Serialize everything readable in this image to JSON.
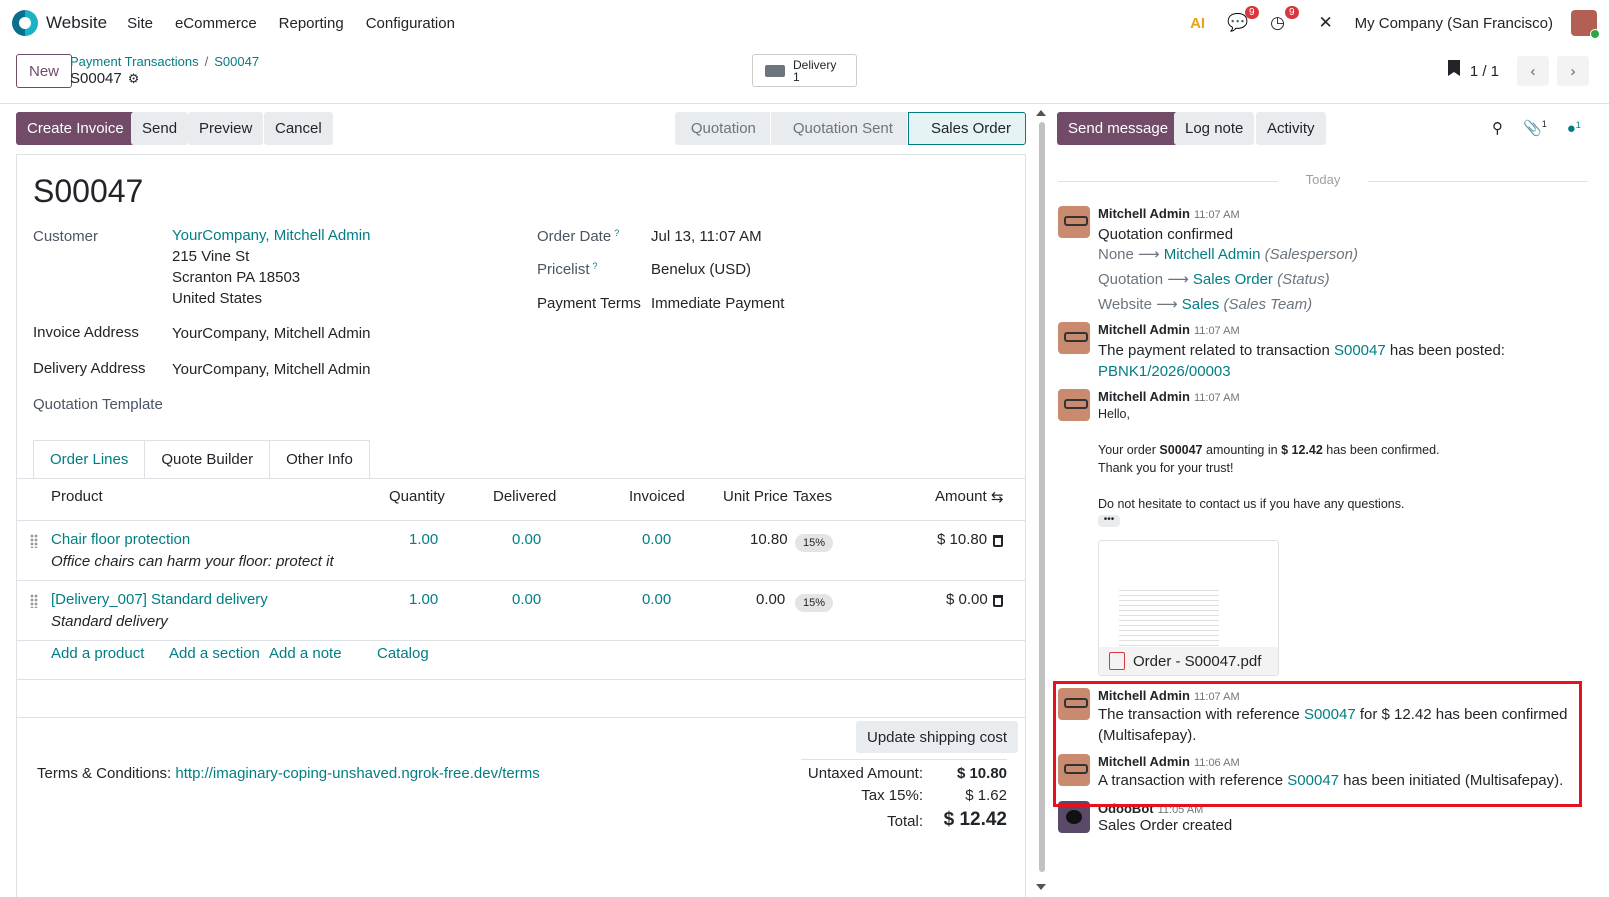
{
  "navbar": {
    "brand": "Website",
    "menu": [
      "Site",
      "eCommerce",
      "Reporting",
      "Configuration"
    ],
    "ai_label": "AI",
    "messages_badge": "9",
    "activity_badge": "9",
    "company": "My Company (San Francisco)"
  },
  "control": {
    "new_label": "New",
    "breadcrumb_parent": "Payment Transactions",
    "breadcrumb_current": "S00047",
    "record_name": "S00047",
    "smart_delivery_label": "Delivery",
    "smart_delivery_count": "1",
    "pager": "1 / 1"
  },
  "statusbar": {
    "create_invoice": "Create Invoice",
    "send": "Send",
    "preview": "Preview",
    "cancel": "Cancel",
    "stages": [
      "Quotation",
      "Quotation Sent",
      "Sales Order"
    ]
  },
  "form": {
    "title": "S00047",
    "customer_label": "Customer",
    "customer_name": "YourCompany, Mitchell Admin",
    "customer_addr1": "215 Vine St",
    "customer_addr2": "Scranton PA 18503",
    "customer_addr3": "United States",
    "invoice_address_label": "Invoice Address",
    "invoice_address": "YourCompany, Mitchell Admin",
    "delivery_address_label": "Delivery Address",
    "delivery_address": "YourCompany, Mitchell Admin",
    "quotation_template_label": "Quotation Template",
    "order_date_label": "Order Date",
    "order_date": "Jul 13, 11:07 AM",
    "pricelist_label": "Pricelist",
    "pricelist": "Benelux (USD)",
    "payment_terms_label": "Payment Terms",
    "payment_terms": "Immediate Payment",
    "help_mark": "?"
  },
  "tabs": [
    "Order Lines",
    "Quote Builder",
    "Other Info"
  ],
  "table": {
    "headers": {
      "product": "Product",
      "quantity": "Quantity",
      "delivered": "Delivered",
      "invoiced": "Invoiced",
      "unit_price": "Unit Price",
      "taxes": "Taxes",
      "amount": "Amount"
    },
    "rows": [
      {
        "product": "Chair floor protection",
        "description": "Office chairs can harm your floor: protect it",
        "quantity": "1.00",
        "delivered": "0.00",
        "invoiced": "0.00",
        "unit_price": "10.80",
        "tax": "15%",
        "amount": "$ 10.80"
      },
      {
        "product": "[Delivery_007] Standard delivery",
        "description": "Standard delivery",
        "quantity": "1.00",
        "delivered": "0.00",
        "invoiced": "0.00",
        "unit_price": "0.00",
        "tax": "15%",
        "amount": "$ 0.00"
      }
    ],
    "add_product": "Add a product",
    "add_section": "Add a section",
    "add_note": "Add a note",
    "catalog": "Catalog"
  },
  "footer": {
    "update_shipping": "Update shipping cost",
    "terms_label": "Terms & Conditions:",
    "terms_url": "http://imaginary-coping-unshaved.ngrok-free.dev/terms",
    "untaxed_label": "Untaxed Amount:",
    "untaxed_value": "$ 10.80",
    "tax_label": "Tax 15%:",
    "tax_value": "$ 1.62",
    "total_label": "Total:",
    "total_value": "$ 12.42"
  },
  "chatter": {
    "send_message": "Send message",
    "log_note": "Log note",
    "activity": "Activity",
    "attachments_count": "1",
    "followers_count": "1",
    "today": "Today",
    "messages": [
      {
        "author": "Mitchell Admin",
        "time": "11:07 AM",
        "text": "Quotation confirmed",
        "tracking": [
          {
            "old": "None",
            "new": "Mitchell Admin",
            "field": "(Salesperson)"
          },
          {
            "old": "Quotation",
            "new": "Sales Order",
            "field": "(Status)"
          },
          {
            "old": "Website",
            "new": "Sales",
            "field": "(Sales Team)"
          }
        ]
      },
      {
        "author": "Mitchell Admin",
        "time": "11:07 AM",
        "text_pre": "The payment related to transaction",
        "link": "S00047",
        "text_post": "has been posted:",
        "link2": "PBNK1/2026/00003"
      },
      {
        "author": "Mitchell Admin",
        "time": "11:07 AM",
        "hello": "Hello,",
        "line1_pre": "Your order",
        "line1_order": "S00047",
        "line1_mid": "amounting in",
        "line1_amount": "$ 12.42",
        "line1_post": "has been confirmed.",
        "line2": "Thank you for your trust!",
        "line3": "Do not hesitate to contact us if you have any questions.",
        "attachment": "Order - S00047.pdf"
      },
      {
        "author": "Mitchell Admin",
        "time": "11:07 AM",
        "text_pre": "The transaction with reference",
        "link": "S00047",
        "text_post": "for $ 12.42 has been confirmed",
        "text_line2": "(Multisafepay)."
      },
      {
        "author": "Mitchell Admin",
        "time": "11:06 AM",
        "text_pre": "A transaction with reference",
        "link": "S00047",
        "text_post": "has been initiated (Multisafepay)."
      },
      {
        "author": "OdooBot",
        "time": "11:05 AM",
        "text": "Sales Order created"
      }
    ]
  }
}
